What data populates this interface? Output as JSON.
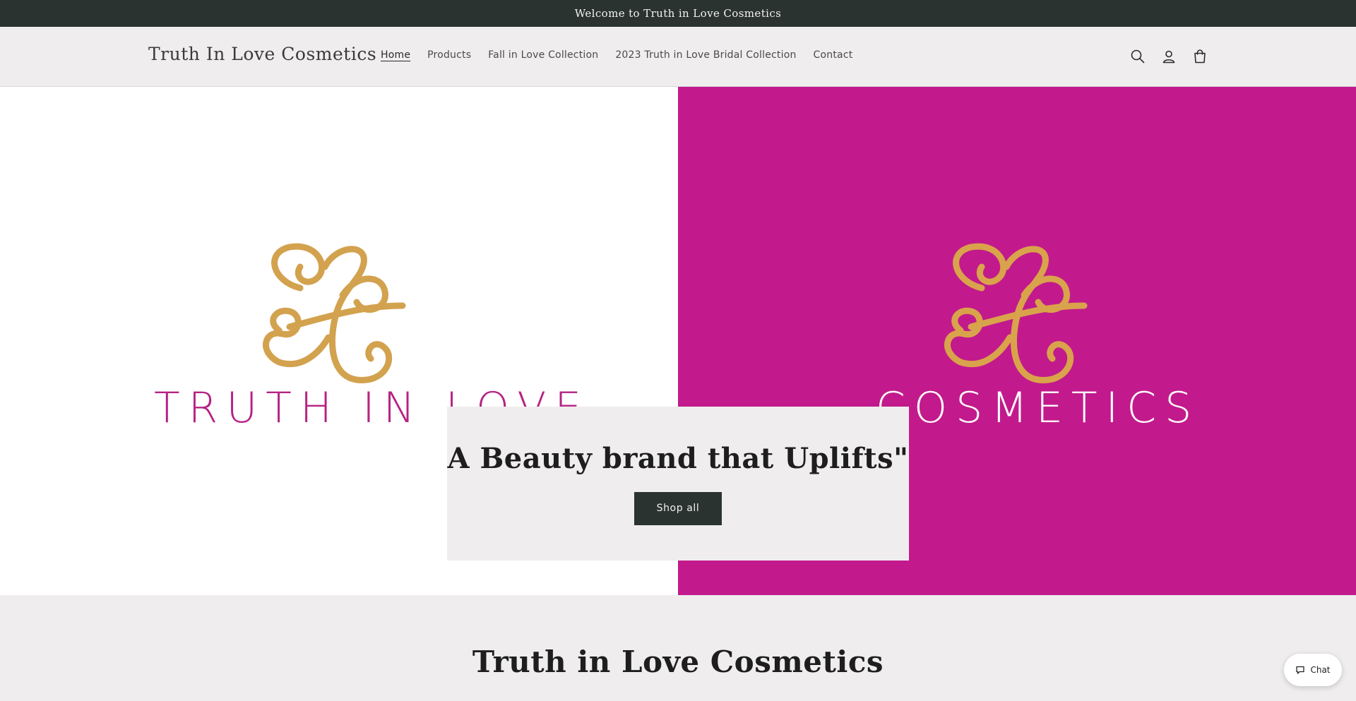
{
  "announcement": {
    "text": "Welcome to Truth in Love Cosmetics"
  },
  "header": {
    "brand": "Truth In Love Cosmetics",
    "nav": [
      {
        "label": "Home",
        "active": true
      },
      {
        "label": "Products"
      },
      {
        "label": "Fall in Love Collection"
      },
      {
        "label": "2023 Truth in Love Bridal Collection"
      },
      {
        "label": "Contact"
      }
    ],
    "icons": [
      "search-icon",
      "account-icon",
      "cart-icon"
    ]
  },
  "hero": {
    "left_wordmark": "TRUTH IN LOVE",
    "right_wordmark": "COSMETICS",
    "title": "A Beauty brand that Uplifts\"",
    "button_label": "Shop all"
  },
  "about": {
    "title": "Truth in Love Cosmetics"
  },
  "chat": {
    "label": "Chat"
  },
  "colors": {
    "announcement_bg": "#2b3331",
    "page_bg": "#efedee",
    "magenta": "#c21a8c",
    "gold": "#d3a24e",
    "button_bg": "#2b3331"
  }
}
